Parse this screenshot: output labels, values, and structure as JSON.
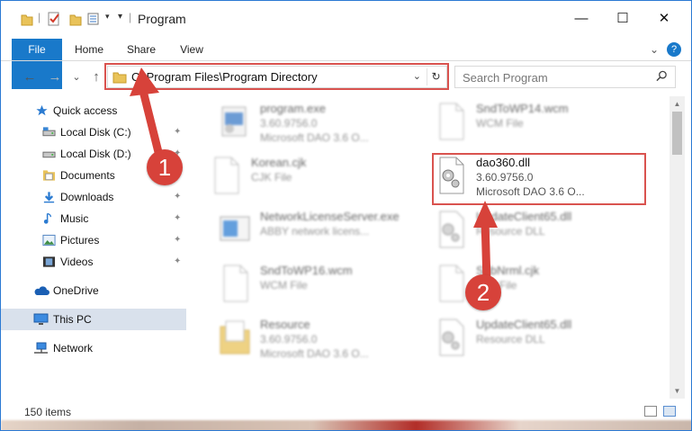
{
  "window": {
    "title": "Program",
    "minimize": "—",
    "maximize": "☐",
    "close": "✕"
  },
  "ribbon": {
    "tabs": [
      "File",
      "Home",
      "Share",
      "View"
    ],
    "expand_label": "⌄",
    "help_label": "?"
  },
  "address": {
    "back": "←",
    "forward": "→",
    "recent": "⌄",
    "up": "↑",
    "path": "C:\\Program Files\\Program Directory",
    "dropdown": "⌄",
    "refresh": "↻"
  },
  "search": {
    "placeholder": "Search Program",
    "icon": "search-icon"
  },
  "sidebar": {
    "items": [
      {
        "label": "Quick access",
        "icon": "star-icon",
        "pinned": false
      },
      {
        "label": "Local Disk (C:)",
        "icon": "drive-icon",
        "pinned": true
      },
      {
        "label": "Local Disk (D:)",
        "icon": "drive-icon",
        "pinned": true
      },
      {
        "label": "Documents",
        "icon": "documents-icon",
        "pinned": true
      },
      {
        "label": "Downloads",
        "icon": "download-icon",
        "pinned": true
      },
      {
        "label": "Music",
        "icon": "music-icon",
        "pinned": true
      },
      {
        "label": "Pictures",
        "icon": "pictures-icon",
        "pinned": true
      },
      {
        "label": "Videos",
        "icon": "video-icon",
        "pinned": true
      },
      {
        "label": "OneDrive",
        "icon": "cloud-icon",
        "pinned": false
      },
      {
        "label": "This PC",
        "icon": "computer-icon",
        "pinned": false,
        "selected": true
      },
      {
        "label": "Network",
        "icon": "network-icon",
        "pinned": false
      }
    ],
    "pin_glyph": "📌"
  },
  "files": [
    {
      "name": "program.exe",
      "line2": "3.60.9756.0",
      "line3": "Microsoft DAO 3.6 O...",
      "icon": "exe-icon"
    },
    {
      "name": "SndToWP14.wcm",
      "line2": "WCM File",
      "line3": "",
      "icon": "blank-file-icon"
    },
    {
      "name": "Korean.cjk",
      "line2": "CJK File",
      "line3": "",
      "icon": "blank-file-icon"
    },
    {
      "name": "dao360.dll",
      "line2": "3.60.9756.0",
      "line3": "Microsoft DAO 3.6 O...",
      "icon": "dll-gear-icon"
    },
    {
      "name": "NetworkLicenseServer.exe",
      "line2": "ABBY network licens...",
      "line3": "",
      "icon": "window-app-icon"
    },
    {
      "name": "UpdateClient65.dll",
      "line2": "Resource DLL",
      "line3": "",
      "icon": "dll-gear-icon"
    },
    {
      "name": "SndToWP16.wcm",
      "line2": "WCM File",
      "line3": "",
      "icon": "blank-file-icon"
    },
    {
      "name": "SubNrml.cjk",
      "line2": "CJK File",
      "line3": "",
      "icon": "blank-file-icon"
    },
    {
      "name": "Resource",
      "line2": "3.60.9756.0",
      "line3": "Microsoft DAO 3.6 O...",
      "icon": "folder-doc-icon"
    },
    {
      "name": "UpdateClient65.dll",
      "line2": "Resource DLL",
      "line3": "",
      "icon": "dll-gear-icon"
    }
  ],
  "status": {
    "count": "150 items"
  },
  "annotations": {
    "step1": "1",
    "step2": "2",
    "highlight_color": "#d9534f"
  },
  "colors": {
    "accent": "#1979ca",
    "selection": "#d9e1ec"
  }
}
